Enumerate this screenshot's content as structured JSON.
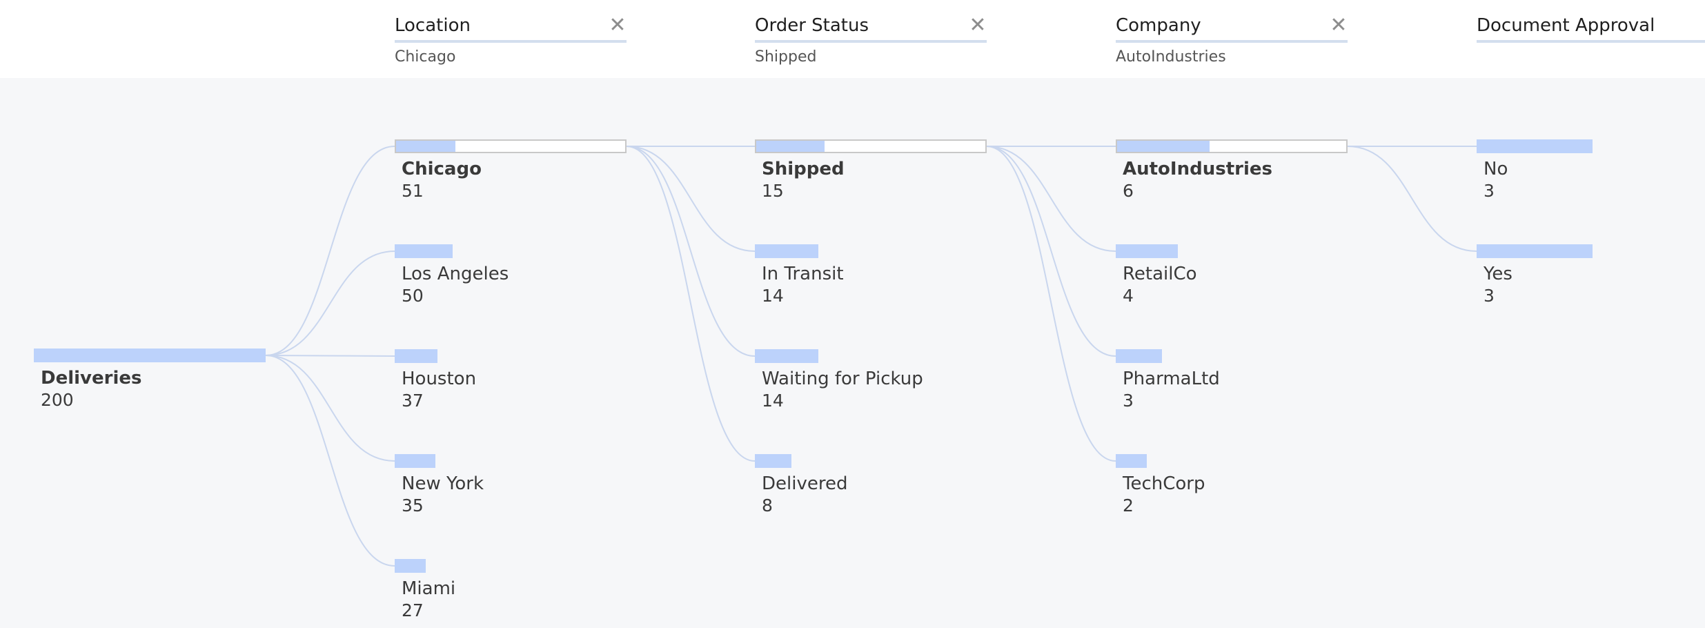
{
  "filters": [
    {
      "title": "Location",
      "value": "Chicago",
      "close_icon": "✕"
    },
    {
      "title": "Order Status",
      "value": "Shipped",
      "close_icon": "✕"
    },
    {
      "title": "Company",
      "value": "AutoIndustries",
      "close_icon": "✕"
    },
    {
      "title": "Document Approval",
      "value": "",
      "close_icon": "✕"
    }
  ],
  "root": {
    "label": "Deliveries",
    "count": "200"
  },
  "levels": [
    {
      "name": "Location",
      "nodes": [
        {
          "label": "Chicago",
          "count": "51",
          "selected": true
        },
        {
          "label": "Los Angeles",
          "count": "50",
          "selected": false
        },
        {
          "label": "Houston",
          "count": "37",
          "selected": false
        },
        {
          "label": "New York",
          "count": "35",
          "selected": false
        },
        {
          "label": "Miami",
          "count": "27",
          "selected": false
        }
      ]
    },
    {
      "name": "Order Status",
      "nodes": [
        {
          "label": "Shipped",
          "count": "15",
          "selected": true
        },
        {
          "label": "In Transit",
          "count": "14",
          "selected": false
        },
        {
          "label": "Waiting for Pickup",
          "count": "14",
          "selected": false
        },
        {
          "label": "Delivered",
          "count": "8",
          "selected": false
        }
      ]
    },
    {
      "name": "Company",
      "nodes": [
        {
          "label": "AutoIndustries",
          "count": "6",
          "selected": true
        },
        {
          "label": "RetailCo",
          "count": "4",
          "selected": false
        },
        {
          "label": "PharmaLtd",
          "count": "3",
          "selected": false
        },
        {
          "label": "TechCorp",
          "count": "2",
          "selected": false
        }
      ]
    },
    {
      "name": "Document Approval",
      "nodes": [
        {
          "label": "No",
          "count": "3",
          "selected": false
        },
        {
          "label": "Yes",
          "count": "3",
          "selected": false
        }
      ]
    }
  ],
  "colors": {
    "bar": "#bcd2fb",
    "link": "#c9d6ee",
    "header_bg": "#ffffff",
    "canvas_bg": "#f6f7f9"
  }
}
